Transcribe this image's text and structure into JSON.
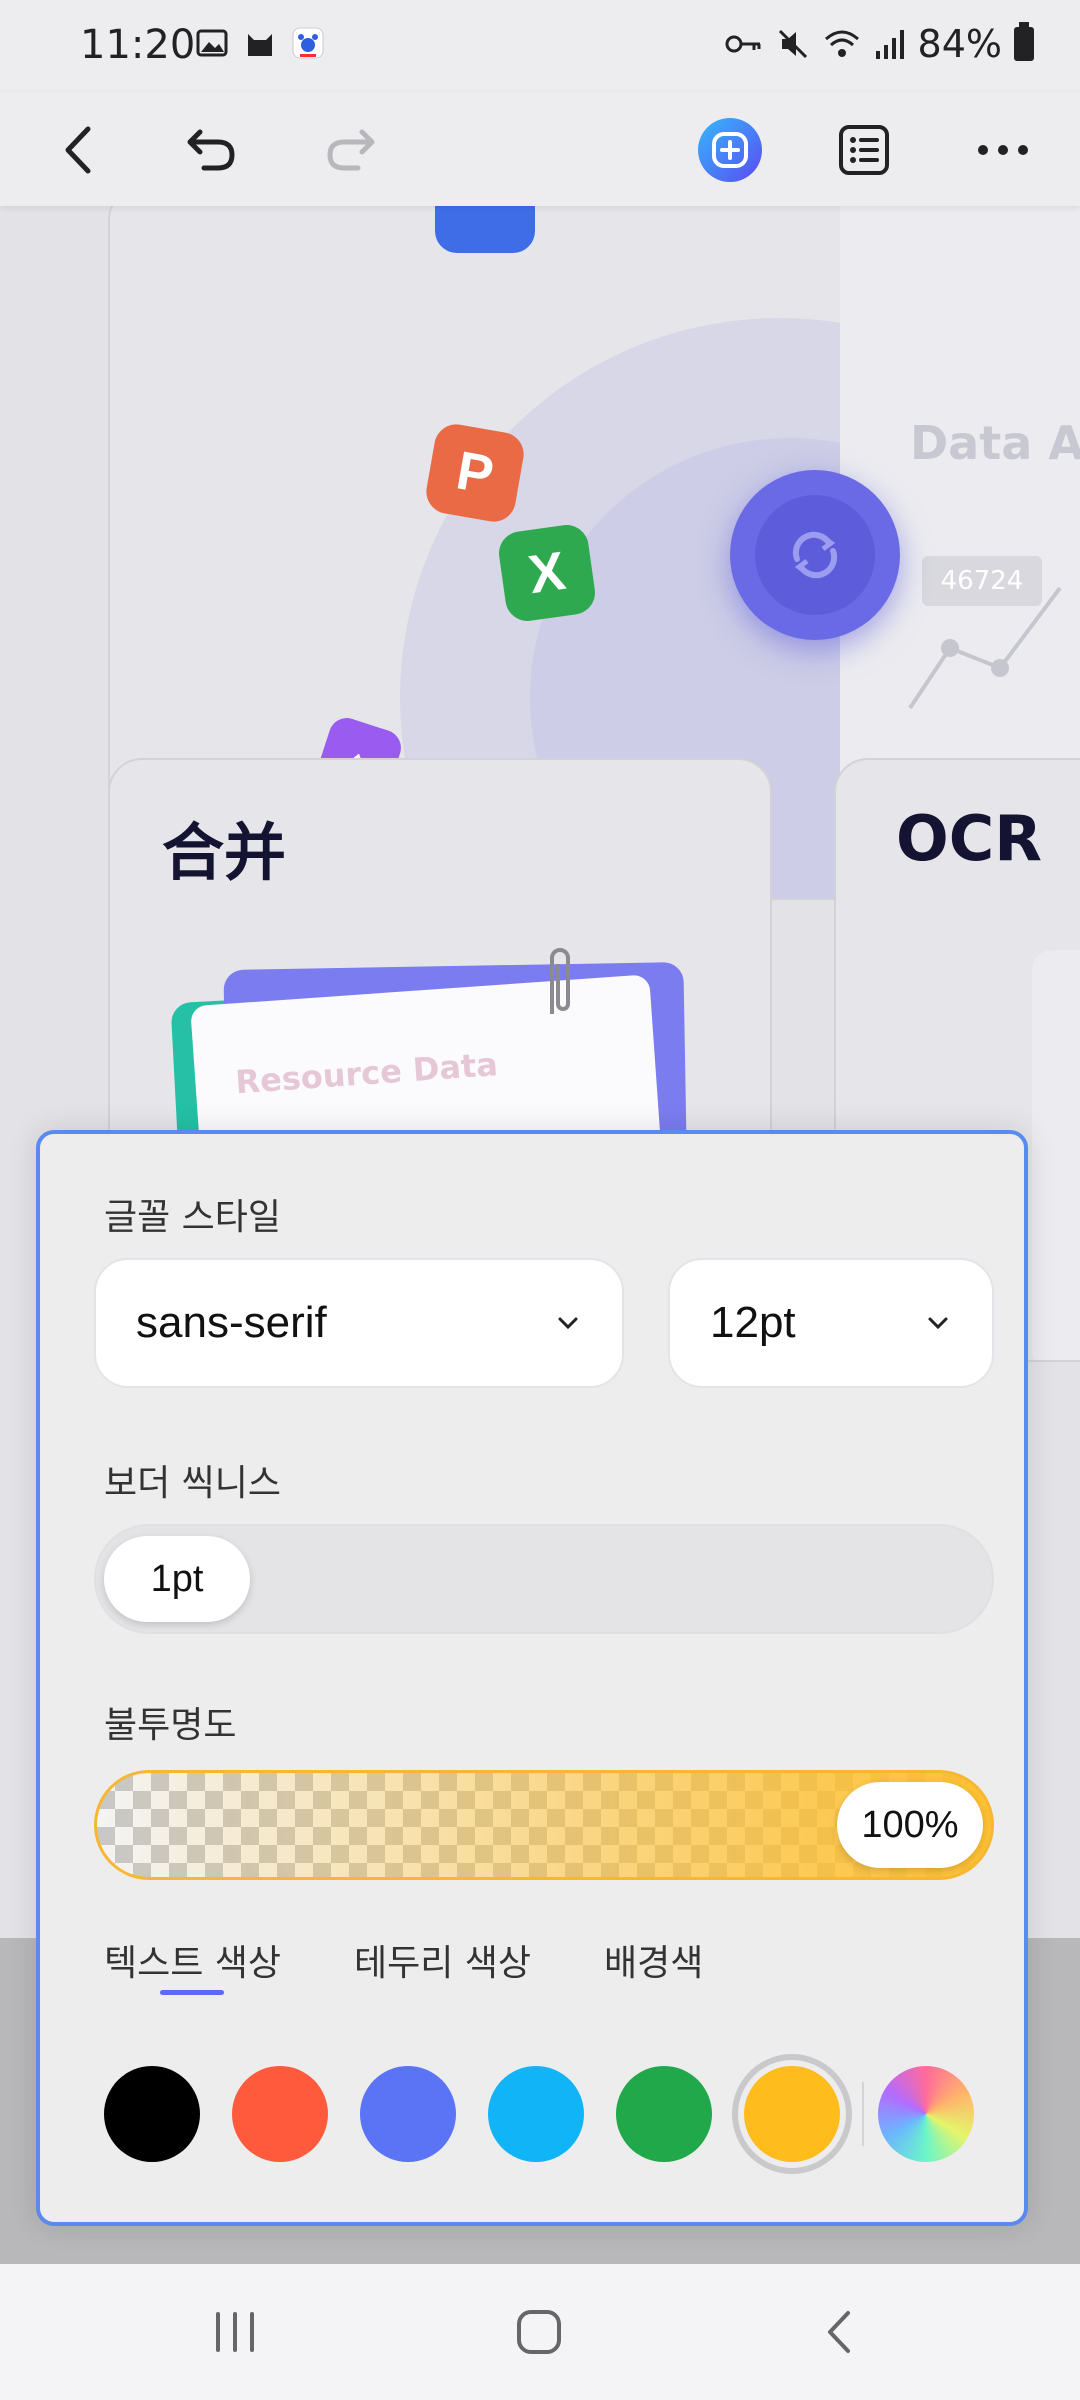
{
  "status_bar": {
    "time": "11:20",
    "battery": "84%",
    "left_icons": [
      "gallery-icon",
      "cat-icon",
      "baidu-icon"
    ],
    "right_icons": [
      "key-icon",
      "mute-icon",
      "wifi-icon",
      "signal-icon",
      "battery-icon"
    ]
  },
  "toolbar": {
    "back": "back-icon",
    "undo": "undo-icon",
    "redo": "redo-icon",
    "ai": "ai-assistant-icon",
    "outline": "outline-icon",
    "more": "more-icon"
  },
  "document": {
    "top_card": {
      "data_title": "Data Ar",
      "data_value": "46724",
      "app_icons": [
        {
          "letter": "P",
          "color": "#ea6a45"
        },
        {
          "letter": "X",
          "color": "#2ea94f"
        }
      ]
    },
    "merge_card": {
      "title": "合并",
      "paper_text": "Resource Data"
    },
    "ocr_card": {
      "title": "OCR"
    }
  },
  "panel": {
    "font_style_label": "글꼴 스타일",
    "font_family": "sans-serif",
    "font_size": "12pt",
    "border_thickness_label": "보더 씩니스",
    "border_thickness_value": "1pt",
    "opacity_label": "불투명도",
    "opacity_value": "100%",
    "opacity_level": 1.0,
    "tabs": [
      {
        "label": "텍스트 색상",
        "selected": true
      },
      {
        "label": "테두리 색상",
        "selected": false
      },
      {
        "label": "배경색",
        "selected": false
      }
    ],
    "swatches": [
      {
        "name": "black",
        "color": "#000000"
      },
      {
        "name": "orange-red",
        "color": "#ff5a3c"
      },
      {
        "name": "blue",
        "color": "#5a74f5"
      },
      {
        "name": "sky-blue",
        "color": "#12b4f8"
      },
      {
        "name": "green",
        "color": "#21a84a"
      },
      {
        "name": "yellow",
        "color": "#ffbc1c",
        "selected": true
      },
      {
        "name": "custom-gradient",
        "color": "gradient"
      }
    ],
    "accent_color": "#5a8af0"
  },
  "navbar": {
    "recents": "recents-icon",
    "home": "home-icon",
    "back": "nav-back-icon"
  }
}
